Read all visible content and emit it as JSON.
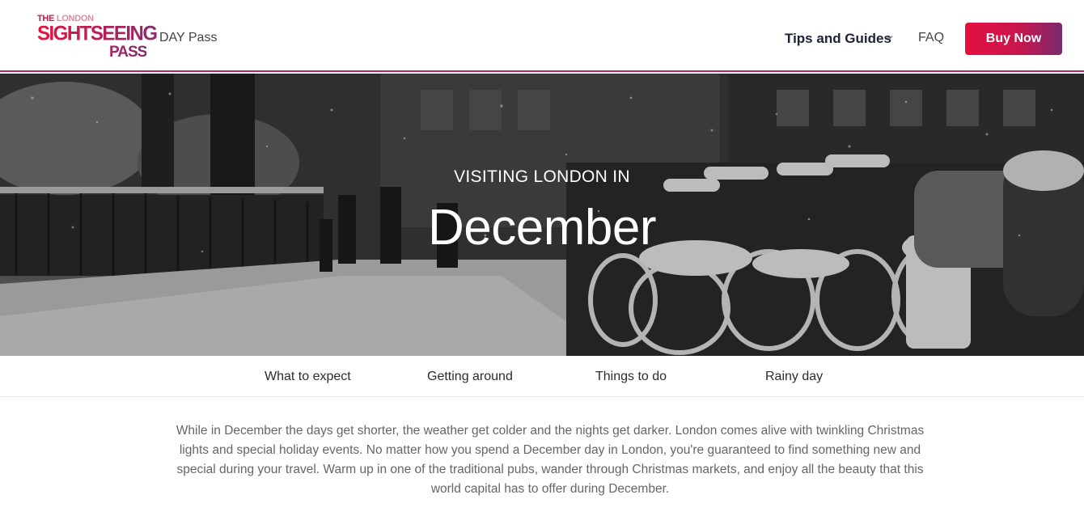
{
  "header": {
    "logo": {
      "line1_a": "THE",
      "line1_b": " LONDON",
      "line2": "SIGHTSEEING",
      "line3": "PASS"
    },
    "day_pass": "DAY Pass",
    "tips_label": "Tips and Guides",
    "faq_label": "FAQ",
    "buy_label": "Buy Now"
  },
  "hero": {
    "kicker": "VISITING LONDON IN",
    "title": "December"
  },
  "subnav": {
    "items": [
      "What to expect",
      "Getting around",
      "Things to do",
      "Rainy day"
    ]
  },
  "intro": {
    "text": "While in December the days get shorter, the weather get colder and the nights get darker. London comes alive with twinkling Christmas lights and special holiday events. No matter how you spend a December day in London, you're guaranteed to find something new and special during your travel. Warm up in one of the traditional pubs, wander through Christmas markets, and enjoy all the beauty that this world capital has to offer during December."
  },
  "colors": {
    "brand_start": "#e4103f",
    "brand_end": "#7a2a6f",
    "header_border": "#b7275a"
  },
  "icons": {
    "tips_chevron": "chevron-down-icon"
  }
}
